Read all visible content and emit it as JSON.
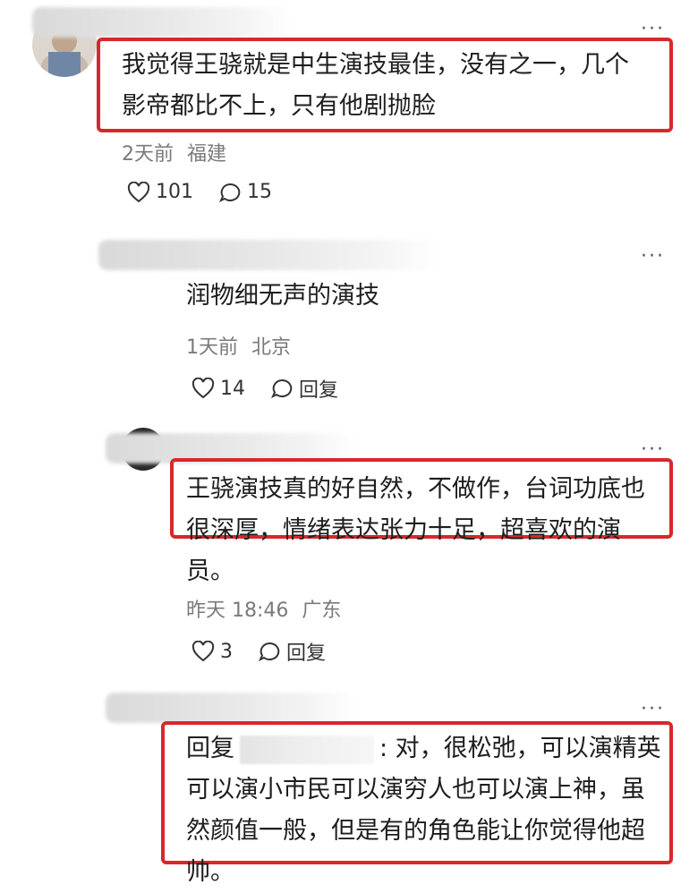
{
  "comments": [
    {
      "text": "我觉得王骁就是中生演技最佳，没有之一，几个影帝都比不上，只有他剧抛脸",
      "line1": "我觉得王骁就是中生演技最佳，没有之一，几个",
      "line2": "影帝都比不上，只有他剧抛脸",
      "time": "2天前",
      "location": "福建",
      "likes": "101",
      "replies": "15"
    },
    {
      "text": "润物细无声的演技",
      "time": "1天前",
      "location": "北京",
      "likes": "14",
      "reply_label": "回复"
    },
    {
      "line1": "王骁演技真的好自然，不做作，台词功底也",
      "line2": "很深厚，情绪表达张力十足，超喜欢的演",
      "line3": "员。",
      "time": "昨天 18:46",
      "location": "广东",
      "likes": "3",
      "reply_label": "回复"
    },
    {
      "prefix": "回复",
      "after_mask": ":  对，很松弛，可以演精英",
      "line2": "可以演小市民可以演穷人也可以演上神，虽",
      "line3": "然颜值一般，但是有的角色能让你觉得他超",
      "line4": "帅。"
    }
  ],
  "more_icon": "···",
  "colors": {
    "highlight": "#d8282a",
    "meta": "#7a7a7a"
  }
}
